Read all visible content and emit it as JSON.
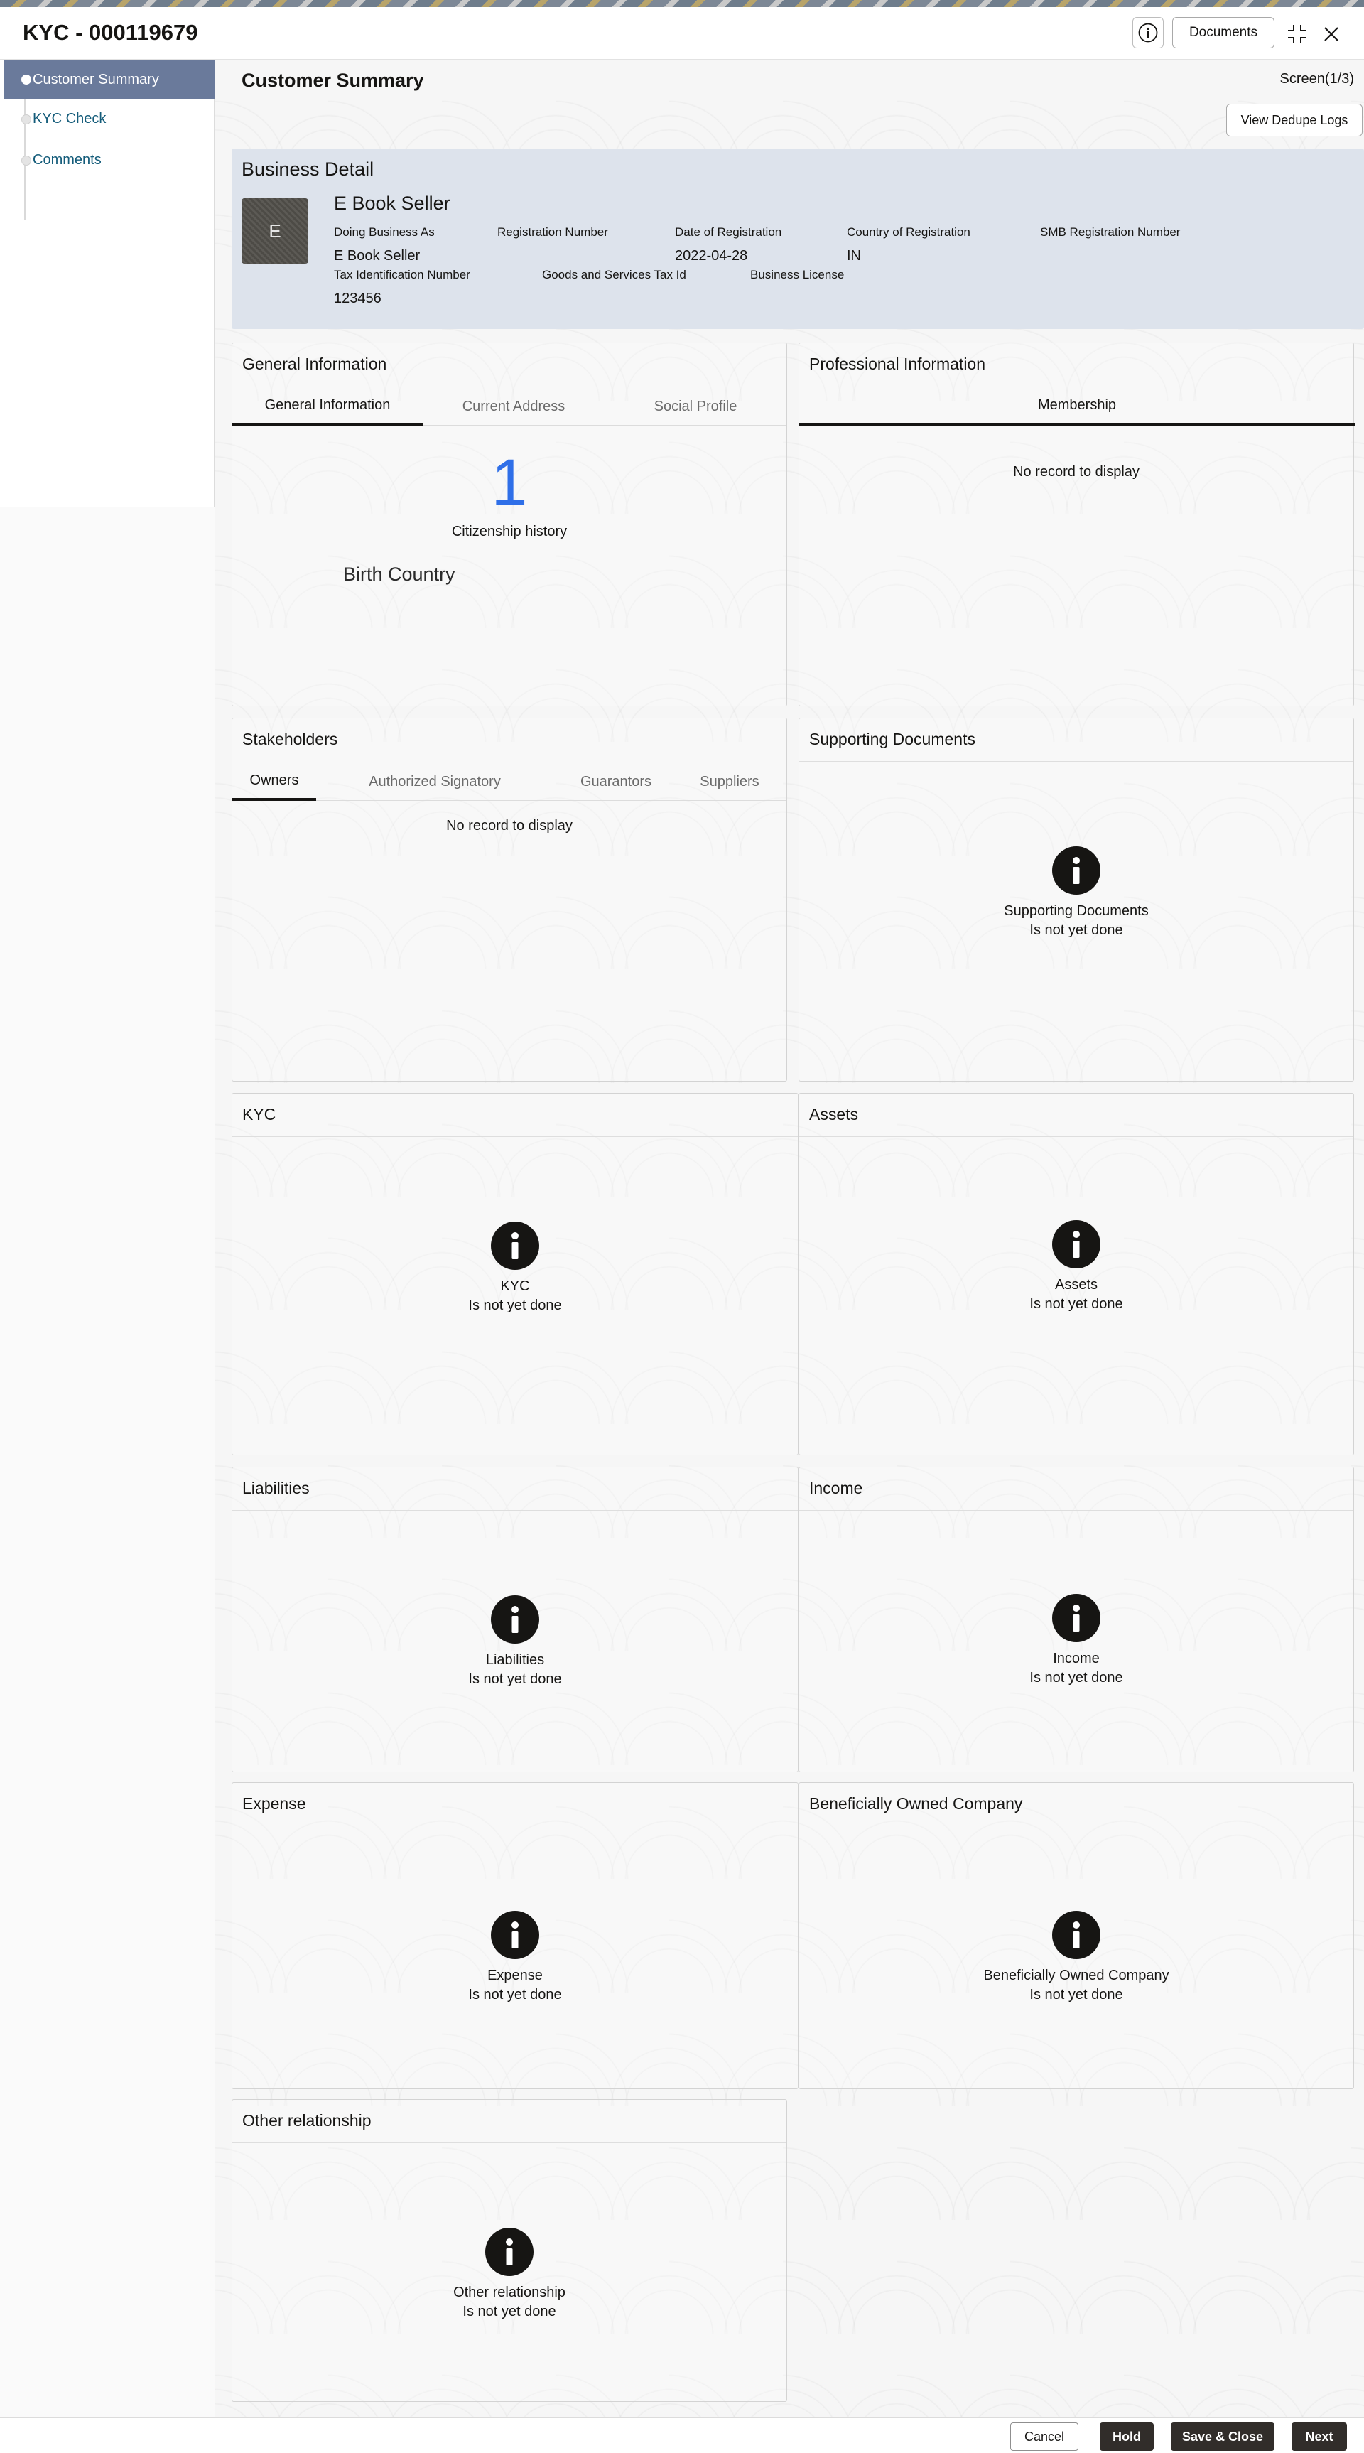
{
  "header": {
    "title": "KYC - 000119679",
    "documents_label": "Documents",
    "info_icon": "info-circle-icon",
    "collapse_icon": "compress-icon",
    "close_icon": "close-icon"
  },
  "sidebar": {
    "items": [
      {
        "label": "Customer Summary",
        "active": true
      },
      {
        "label": "KYC Check",
        "active": false
      },
      {
        "label": "Comments",
        "active": false
      }
    ]
  },
  "page": {
    "title": "Customer Summary",
    "screen": "Screen(1/3)",
    "dedupe_button": "View Dedupe Logs"
  },
  "business_detail": {
    "title": "Business Detail",
    "avatar_letter": "E",
    "name": "E Book Seller",
    "fields_row1": [
      {
        "label": "Doing Business As",
        "value": "E Book Seller"
      },
      {
        "label": "Registration Number",
        "value": ""
      },
      {
        "label": "Date of Registration",
        "value": "2022-04-28"
      },
      {
        "label": "Country of Registration",
        "value": "IN"
      },
      {
        "label": "SMB Registration Number",
        "value": ""
      }
    ],
    "fields_row2": [
      {
        "label": "Tax Identification Number",
        "value": "123456"
      },
      {
        "label": "Goods and Services Tax Id",
        "value": ""
      },
      {
        "label": "Business License",
        "value": ""
      }
    ]
  },
  "general_information": {
    "title": "General Information",
    "tabs": [
      "General Information",
      "Current Address",
      "Social Profile"
    ],
    "citizenship_count": "1",
    "citizenship_label": "Citizenship history",
    "birth_country_label": "Birth Country"
  },
  "professional_information": {
    "title": "Professional Information",
    "tabs": [
      "Membership"
    ],
    "empty": "No record to display"
  },
  "stakeholders": {
    "title": "Stakeholders",
    "tabs": [
      "Owners",
      "Authorized Signatory",
      "Guarantors",
      "Suppliers"
    ],
    "empty": "No record to display"
  },
  "status_text": "Is not yet done",
  "supporting_documents": {
    "title": "Supporting Documents",
    "label": "Supporting Documents"
  },
  "kyc": {
    "title": "KYC",
    "label": "KYC"
  },
  "assets": {
    "title": "Assets",
    "label": "Assets"
  },
  "liabilities": {
    "title": "Liabilities",
    "label": "Liabilities"
  },
  "income": {
    "title": "Income",
    "label": "Income"
  },
  "expense": {
    "title": "Expense",
    "label": "Expense"
  },
  "beneficially_owned": {
    "title": "Beneficially Owned Company",
    "label": "Beneficially Owned Company"
  },
  "other_relationship": {
    "title": "Other relationship",
    "label": "Other relationship"
  },
  "footer": {
    "cancel": "Cancel",
    "hold": "Hold",
    "save_close": "Save & Close",
    "next": "Next"
  },
  "colors": {
    "sidebar_active": "#6a7a9b",
    "business_detail_bg": "#dde3ec",
    "accent_number": "#2f6fe8",
    "dark_button": "#312d2a"
  }
}
